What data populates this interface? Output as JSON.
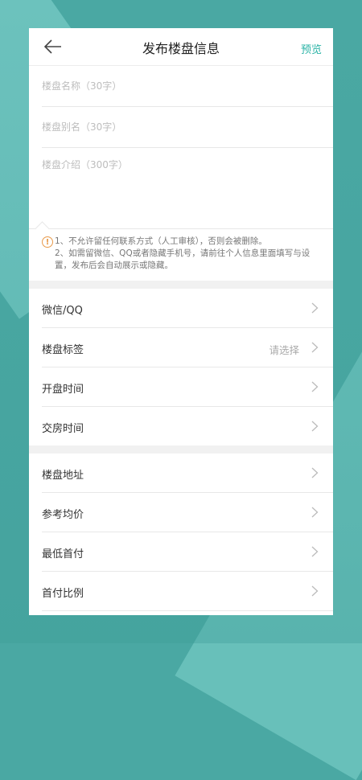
{
  "header": {
    "title": "发布楼盘信息",
    "preview_label": "预览"
  },
  "form": {
    "name_placeholder": "楼盘名称（30字）",
    "alias_placeholder": "楼盘别名（30字）",
    "intro_placeholder": "楼盘介绍（300字）"
  },
  "notice": {
    "line1": "1、不允许留任何联系方式（人工审核），否则会被删除。",
    "line2": "2、如需留微信、QQ或者隐藏手机号，请前往个人信息里面填写与设置，发布后会自动展示或隐藏。"
  },
  "group1": [
    {
      "label": "微信/QQ",
      "value": ""
    },
    {
      "label": "楼盘标签",
      "value": "请选择"
    },
    {
      "label": "开盘时间",
      "value": ""
    },
    {
      "label": "交房时间",
      "value": ""
    }
  ],
  "group2": [
    {
      "label": "楼盘地址",
      "value": ""
    },
    {
      "label": "参考均价",
      "value": ""
    },
    {
      "label": "最低首付",
      "value": ""
    },
    {
      "label": "首付比例",
      "value": ""
    }
  ],
  "colors": {
    "accent": "#2ab3a6",
    "background": "#4aa8a3",
    "warning": "#e89a4a"
  },
  "icons": {
    "back": "back-arrow-icon",
    "warning": "warning-icon",
    "row": "chevron-right-icon"
  }
}
